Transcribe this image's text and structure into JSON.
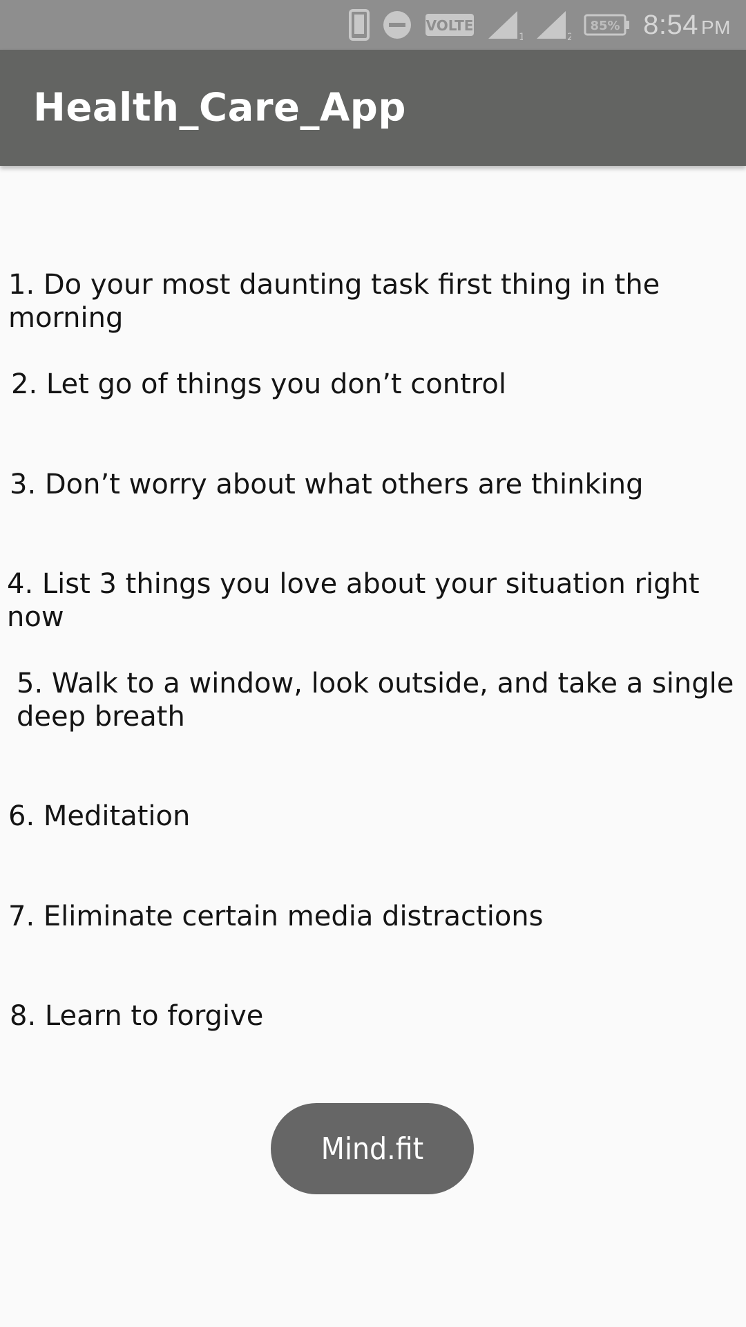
{
  "status_bar": {
    "icons": [
      "phone-icon",
      "do-not-disturb-icon",
      "volte-icon",
      "signal-sim1-icon",
      "signal-sim2-icon",
      "battery-icon"
    ],
    "volte_label": "VOLTE",
    "battery_percent": "85%",
    "time": "8:54",
    "ampm": "PM"
  },
  "app_bar": {
    "title": "Health_Care_App"
  },
  "tips": [
    "1. Do your most daunting task first thing in the morning",
    "2. Let go of things you don’t control",
    "3. Don’t worry about what others are thinking",
    "4. List 3 things you love about your situation right now",
    "5. Walk to a window, look outside, and take a single deep breath",
    "6. Meditation",
    "7. Eliminate certain media distractions",
    "8. Learn to forgive"
  ],
  "button": {
    "label": "Mind.fit"
  },
  "colors": {
    "status_bar": "#8e8e8e",
    "app_bar": "#636462",
    "background": "#fafafa",
    "button": "#666666",
    "text": "#141414"
  }
}
